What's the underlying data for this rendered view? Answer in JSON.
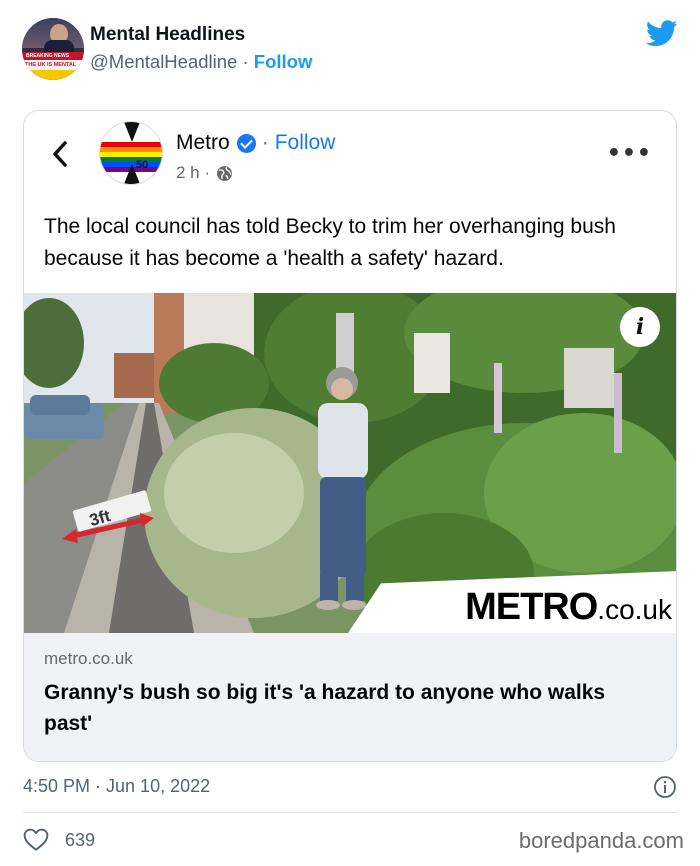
{
  "tweet": {
    "display_name": "Mental Headlines",
    "handle": "@MentalHeadline",
    "separator": "·",
    "follow_label": "Follow",
    "avatar_text_top": "BREAKING NEWS",
    "avatar_text_bottom": "THE UK IS MENTAL",
    "timestamp": "4:50 PM · Jun 10, 2022",
    "like_count": "639"
  },
  "embedded_post": {
    "page_name": "Metro",
    "logo_text": "50",
    "separator": "·",
    "follow_label": "Follow",
    "time_ago": "2 h ·",
    "more_label": "•••",
    "text": "The local council has told Becky to trim her overhanging bush because it has become a 'health a safety' hazard.",
    "photo": {
      "annotation_label": "3ft",
      "info_label": "i",
      "watermark_main": "METRO",
      "watermark_suffix": ".co.uk"
    },
    "link_domain": "metro.co.uk",
    "link_title": "Granny's bush so big it's 'a hazard to anyone who walks past'"
  },
  "source_credit": "boredpanda.com",
  "colors": {
    "twitter_blue": "#1d9bf0",
    "facebook_blue": "#1877f2",
    "muted_text": "#536471",
    "link_preview_bg": "#f0f2f5"
  },
  "icons": [
    "twitter-bird-icon",
    "chevron-left-icon",
    "verified-badge-icon",
    "globe-icon",
    "more-icon",
    "info-icon",
    "heart-icon"
  ]
}
